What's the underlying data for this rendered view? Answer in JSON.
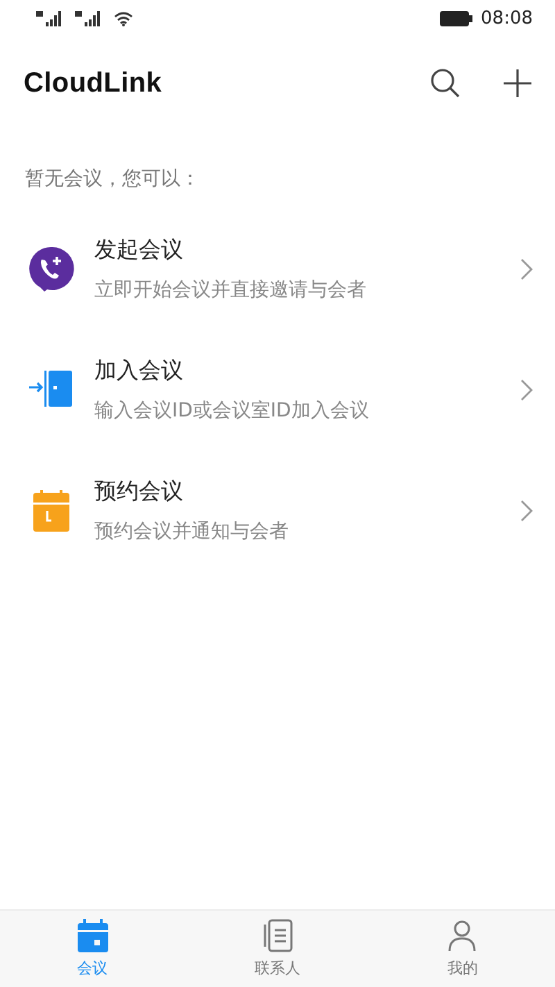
{
  "status_bar": {
    "time": "08:08"
  },
  "header": {
    "title": "CloudLink"
  },
  "section_label": "暂无会议，您可以：",
  "actions": [
    {
      "kind": "start",
      "title": "发起会议",
      "subtitle": "立即开始会议并直接邀请与会者"
    },
    {
      "kind": "join",
      "title": "加入会议",
      "subtitle": "输入会议ID或会议室ID加入会议"
    },
    {
      "kind": "schedule",
      "title": "预约会议",
      "subtitle": "预约会议并通知与会者"
    }
  ],
  "tabs": [
    {
      "kind": "calendar",
      "label": "会议",
      "selected": true
    },
    {
      "kind": "contacts",
      "label": "联系人",
      "selected": false
    },
    {
      "kind": "me",
      "label": "我的",
      "selected": false
    }
  ]
}
